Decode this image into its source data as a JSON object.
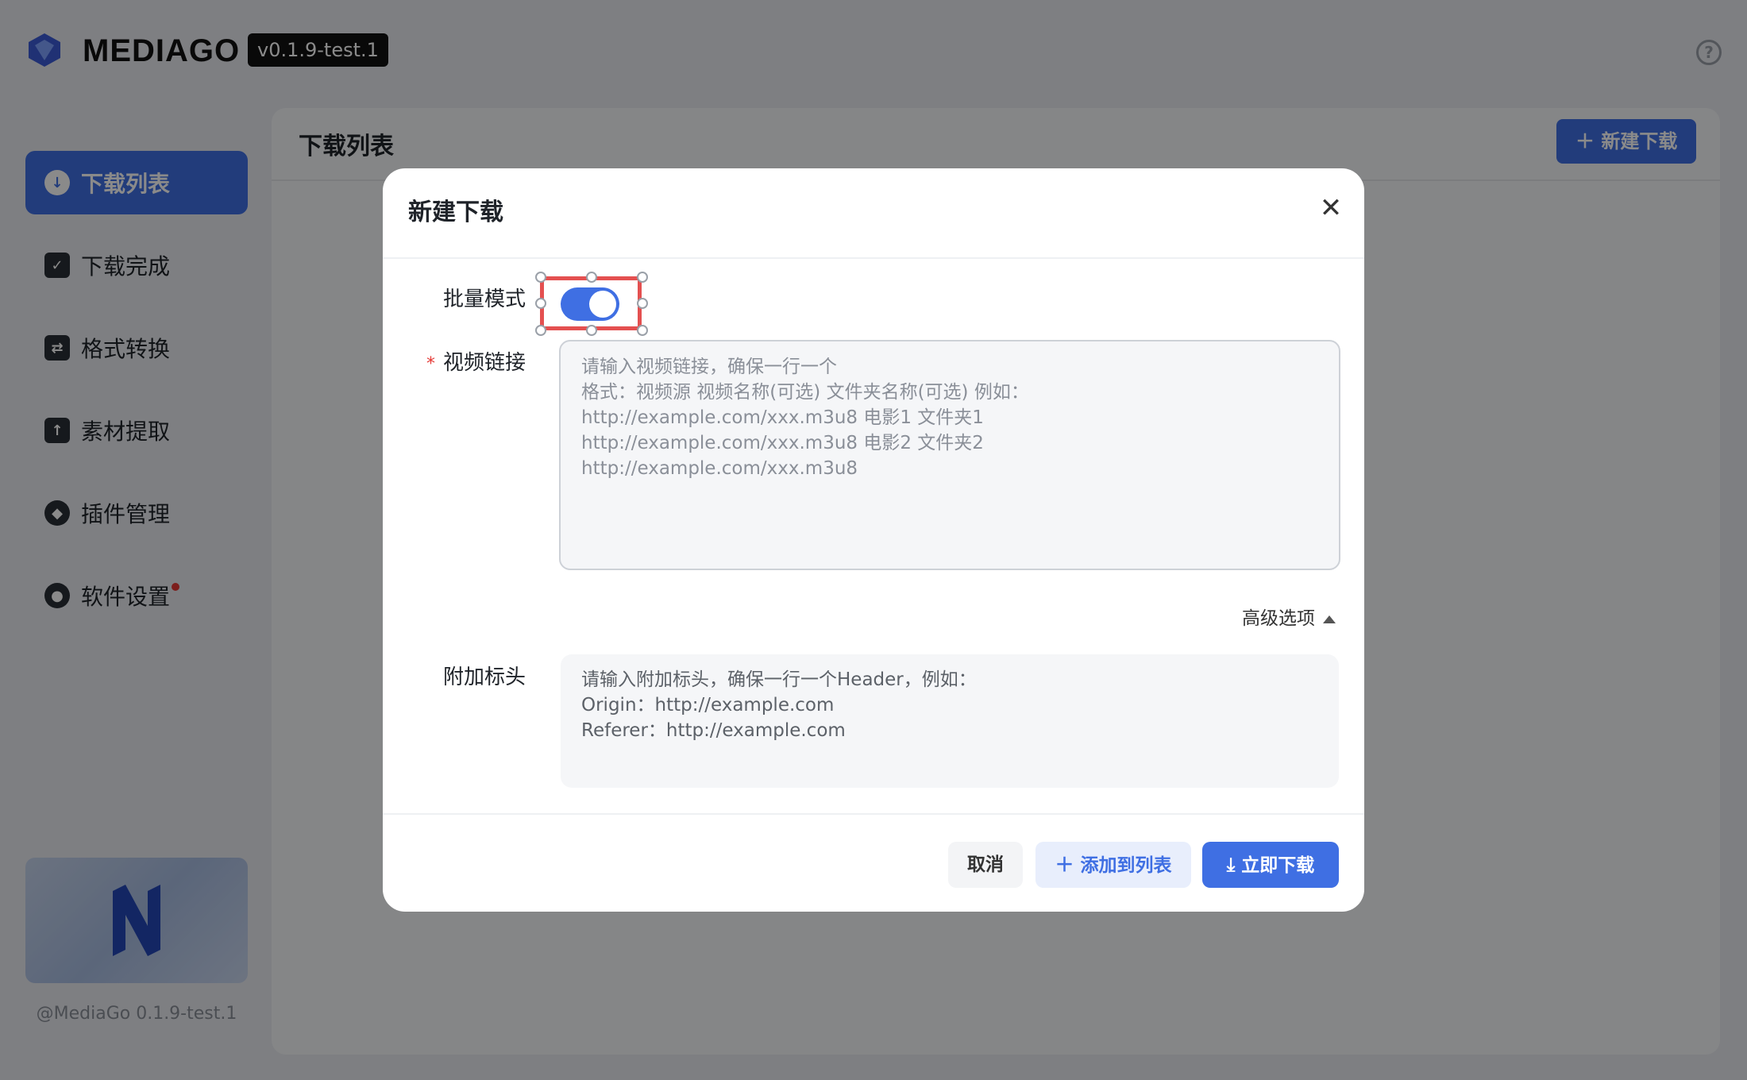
{
  "app": {
    "brand": "MEDIAGO",
    "version": "v0.1.9-test.1",
    "footer": "@MediaGo 0.1.9-test.1"
  },
  "sidebar": {
    "items": [
      {
        "label": "下载列表",
        "icon": "cloud-download-icon",
        "active": true
      },
      {
        "label": "下载完成",
        "icon": "folder-icon",
        "active": false
      },
      {
        "label": "格式转换",
        "icon": "convert-icon",
        "active": false
      },
      {
        "label": "素材提取",
        "icon": "upload-icon",
        "active": false
      },
      {
        "label": "插件管理",
        "icon": "cube-icon",
        "active": false
      },
      {
        "label": "软件设置",
        "icon": "settings-icon",
        "active": false,
        "badge_dot": true
      }
    ]
  },
  "main": {
    "title": "下载列表",
    "new_button": "新建下载"
  },
  "modal": {
    "title": "新建下载",
    "batch_label": "批量模式",
    "batch_enabled": true,
    "url_label": "视频链接",
    "url_placeholder": "请输入视频链接，确保一行一个\n格式：视频源 视频名称(可选) 文件夹名称(可选) 例如：\nhttp://example.com/xxx.m3u8 电影1 文件夹1\nhttp://example.com/xxx.m3u8 电影2 文件夹2\nhttp://example.com/xxx.m3u8",
    "advanced_label": "高级选项",
    "headers_label": "附加标头",
    "headers_placeholder": "请输入附加标头，确保一行一个Header，例如：\nOrigin：http://example.com\nReferer：http://example.com",
    "cancel": "取消",
    "add_to_list": "添加到列表",
    "download_now": "立即下载"
  },
  "colors": {
    "accent": "#3f6fe3",
    "selection": "#e45050",
    "required": "#e53935"
  }
}
